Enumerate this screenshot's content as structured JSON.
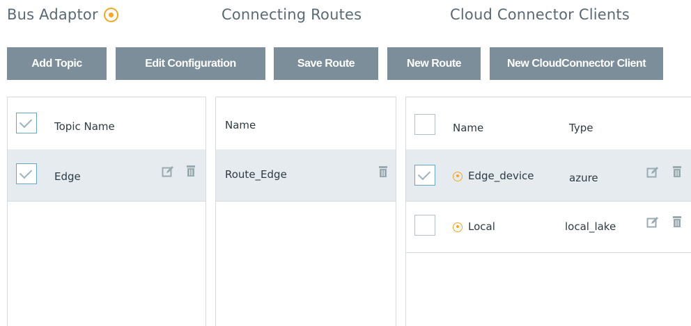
{
  "tabs": {
    "bus_adaptor": "Bus Adaptor",
    "connecting_routes": "Connecting Routes",
    "cloud_connector_clients": "Cloud Connector Clients"
  },
  "toolbar": {
    "add_topic": "Add Topic",
    "edit_configuration": "Edit Configuration",
    "save_route": "Save Route",
    "new_route": "New Route",
    "new_cloudconnector_client": "New CloudConnector Client"
  },
  "topics": {
    "header": "Topic Name",
    "header_checked": true,
    "rows": [
      {
        "name": "Edge",
        "checked": true,
        "selected": true
      }
    ]
  },
  "routes": {
    "header": "Name",
    "rows": [
      {
        "name": "Route_Edge",
        "selected": true
      }
    ]
  },
  "clients": {
    "header_name": "Name",
    "header_type": "Type",
    "header_checked": false,
    "rows": [
      {
        "name": "Edge_device",
        "type": "azure",
        "checked": true,
        "selected": true,
        "status": "active"
      },
      {
        "name": "Local",
        "type": "local_lake",
        "checked": false,
        "selected": false,
        "status": "active"
      }
    ]
  },
  "icons": {
    "status": "status-ring-icon",
    "edit": "edit-icon",
    "delete": "trash-icon",
    "check": "checkmark-icon"
  },
  "colors": {
    "button_bg": "#7b8e9a",
    "status_accent": "#f5a623",
    "selected_row": "#e6ebef",
    "border": "#d4dadd",
    "tab_text": "#5a6a74"
  }
}
